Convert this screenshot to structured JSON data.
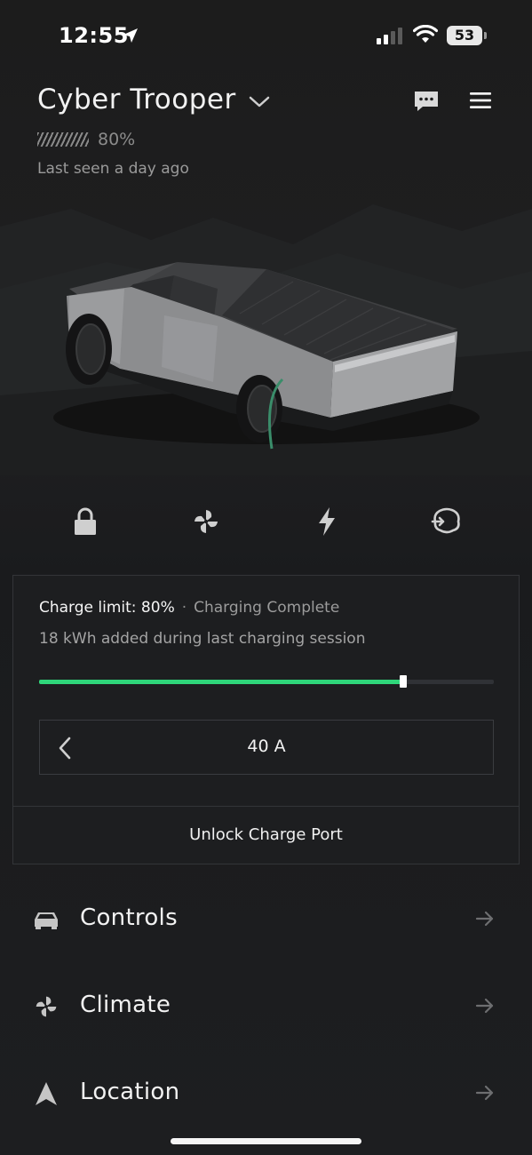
{
  "status_bar": {
    "time": "12:55",
    "battery_level": "53"
  },
  "header": {
    "vehicle_name": "Cyber Trooper",
    "battery_percent": "80%",
    "battery_fraction": 0.8,
    "last_seen": "Last seen a day ago"
  },
  "quick_actions": [
    {
      "icon": "lock-icon"
    },
    {
      "icon": "fan-icon"
    },
    {
      "icon": "lightning-icon"
    },
    {
      "icon": "frunk-icon"
    }
  ],
  "charging": {
    "limit_label": "Charge limit: 80%",
    "separator": "·",
    "status": "Charging Complete",
    "session_text": "18 kWh added during last charging session",
    "charge_limit_fraction": 0.8,
    "current": "40 A",
    "unlock_label": "Unlock Charge Port",
    "accent_color": "#2fd67a"
  },
  "nav": [
    {
      "label": "Controls",
      "icon": "car-icon"
    },
    {
      "label": "Climate",
      "icon": "fan-icon"
    },
    {
      "label": "Location",
      "icon": "location-arrow-icon"
    }
  ]
}
